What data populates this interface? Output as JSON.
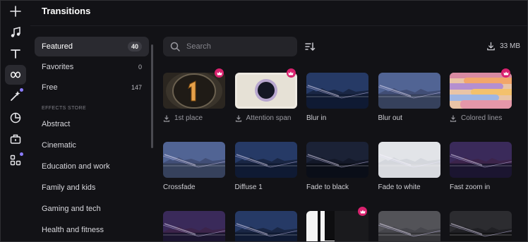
{
  "panel": {
    "title": "Transitions"
  },
  "rail": {
    "items": [
      {
        "name": "add-icon",
        "active": false
      },
      {
        "name": "music-icon",
        "active": false
      },
      {
        "name": "text-icon",
        "active": false
      },
      {
        "name": "transitions-icon",
        "active": true
      },
      {
        "name": "effects-icon",
        "active": false
      },
      {
        "name": "stickers-icon",
        "active": false
      },
      {
        "name": "business-icon",
        "active": false
      },
      {
        "name": "apps-icon",
        "active": false
      }
    ]
  },
  "categories": [
    {
      "label": "Featured",
      "count": "40",
      "active": true
    },
    {
      "label": "Favorites",
      "count": "0"
    },
    {
      "label": "Free",
      "count": "147"
    }
  ],
  "effects_store": {
    "header": "EFFECTS STORE",
    "items": [
      "Abstract",
      "Cinematic",
      "Education and work",
      "Family and kids",
      "Gaming and tech",
      "Health and fitness"
    ]
  },
  "search": {
    "placeholder": "Search",
    "value": ""
  },
  "download_size": "33 MB",
  "accent": "#d8226e",
  "tiles": [
    {
      "label": "1st place",
      "download": true,
      "premium": true,
      "scene": "place"
    },
    {
      "label": "Attention span",
      "download": true,
      "premium": true,
      "scene": "attention"
    },
    {
      "label": "Blur in",
      "download": false,
      "premium": false,
      "scene": "city-blue"
    },
    {
      "label": "Blur out",
      "download": false,
      "premium": false,
      "scene": "city-blue-hazy"
    },
    {
      "label": "Colored lines",
      "download": true,
      "premium": true,
      "scene": "lines"
    },
    {
      "label": "Crossfade",
      "download": false,
      "premium": false,
      "scene": "city-blue-hazy"
    },
    {
      "label": "Diffuse 1",
      "download": false,
      "premium": false,
      "scene": "city-blue"
    },
    {
      "label": "Fade to black",
      "download": false,
      "premium": false,
      "scene": "city-dark"
    },
    {
      "label": "Fade to white",
      "download": false,
      "premium": false,
      "scene": "city-white"
    },
    {
      "label": "Fast zoom in",
      "download": false,
      "premium": false,
      "scene": "city-purple"
    },
    {
      "label": "",
      "download": false,
      "premium": false,
      "scene": "city-purple"
    },
    {
      "label": "",
      "download": false,
      "premium": false,
      "scene": "city-blue"
    },
    {
      "label": "",
      "download": false,
      "premium": true,
      "scene": "blackwhite"
    },
    {
      "label": "",
      "download": false,
      "premium": false,
      "scene": "city-gray"
    },
    {
      "label": "",
      "download": false,
      "premium": false,
      "scene": "city-mono"
    }
  ]
}
